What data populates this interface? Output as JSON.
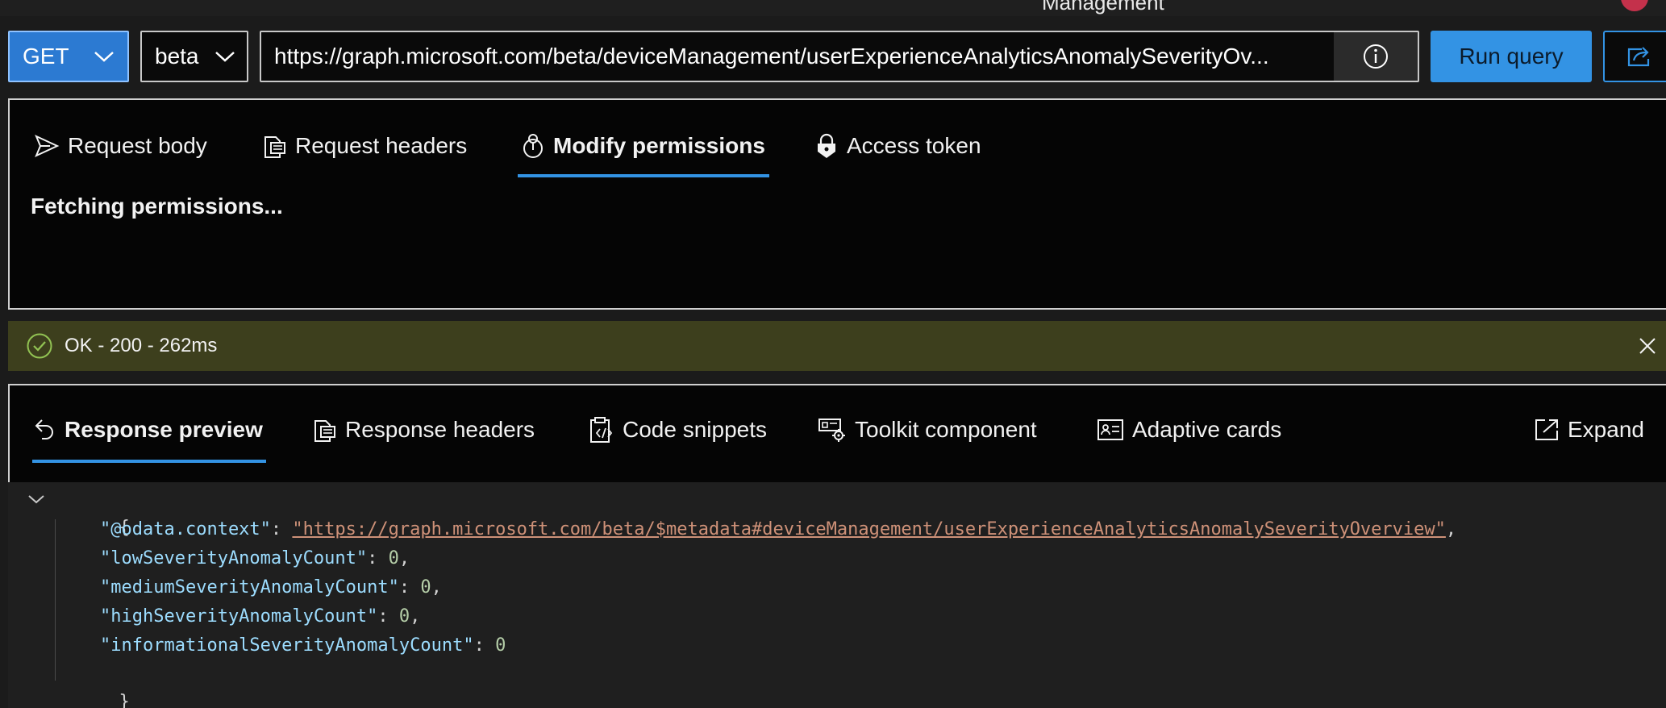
{
  "window": {
    "title_fragment": "Management"
  },
  "query_bar": {
    "method": "GET",
    "version": "beta",
    "url": "https://graph.microsoft.com/beta/deviceManagement/userExperienceAnalyticsAnomalySeverityOv...",
    "run_label": "Run query"
  },
  "request_tabs": [
    {
      "label": "Request body",
      "icon": "send-icon"
    },
    {
      "label": "Request headers",
      "icon": "document-headers-icon"
    },
    {
      "label": "Modify permissions",
      "icon": "permissions-icon",
      "active": true
    },
    {
      "label": "Access token",
      "icon": "lock-icon"
    }
  ],
  "request_panel": {
    "message": "Fetching permissions..."
  },
  "status": {
    "text": "OK - 200 - 262ms",
    "icon": "check-circle-icon"
  },
  "response_tabs": [
    {
      "label": "Response preview",
      "icon": "undo-arrow-icon",
      "active": true
    },
    {
      "label": "Response headers",
      "icon": "document-headers-icon"
    },
    {
      "label": "Code snippets",
      "icon": "code-clipboard-icon"
    },
    {
      "label": "Toolkit component",
      "icon": "toolkit-gear-icon"
    },
    {
      "label": "Adaptive cards",
      "icon": "contact-card-icon"
    }
  ],
  "expand": {
    "label": "Expand",
    "icon": "expand-icon"
  },
  "response_json": {
    "open_brace": "{",
    "close_brace": "}",
    "lines": [
      {
        "key": "\"@odata.context\"",
        "value": "\"https://graph.microsoft.com/beta/$metadata#deviceManagement/userExperienceAnalyticsAnomalySeverityOverview\"",
        "type": "link",
        "trail": ","
      },
      {
        "key": "\"lowSeverityAnomalyCount\"",
        "value": "0",
        "type": "number",
        "trail": ","
      },
      {
        "key": "\"mediumSeverityAnomalyCount\"",
        "value": "0",
        "type": "number",
        "trail": ","
      },
      {
        "key": "\"highSeverityAnomalyCount\"",
        "value": "0",
        "type": "number",
        "trail": ","
      },
      {
        "key": "\"informationalSeverityAnomalyCount\"",
        "value": "0",
        "type": "number",
        "trail": ""
      }
    ]
  },
  "colors": {
    "accent": "#3393e4",
    "status_bg": "#3d3f1d",
    "status_ok": "#92c353",
    "json_key": "#9cdcfe",
    "json_string": "#ce9178",
    "json_number": "#b5cea8"
  }
}
